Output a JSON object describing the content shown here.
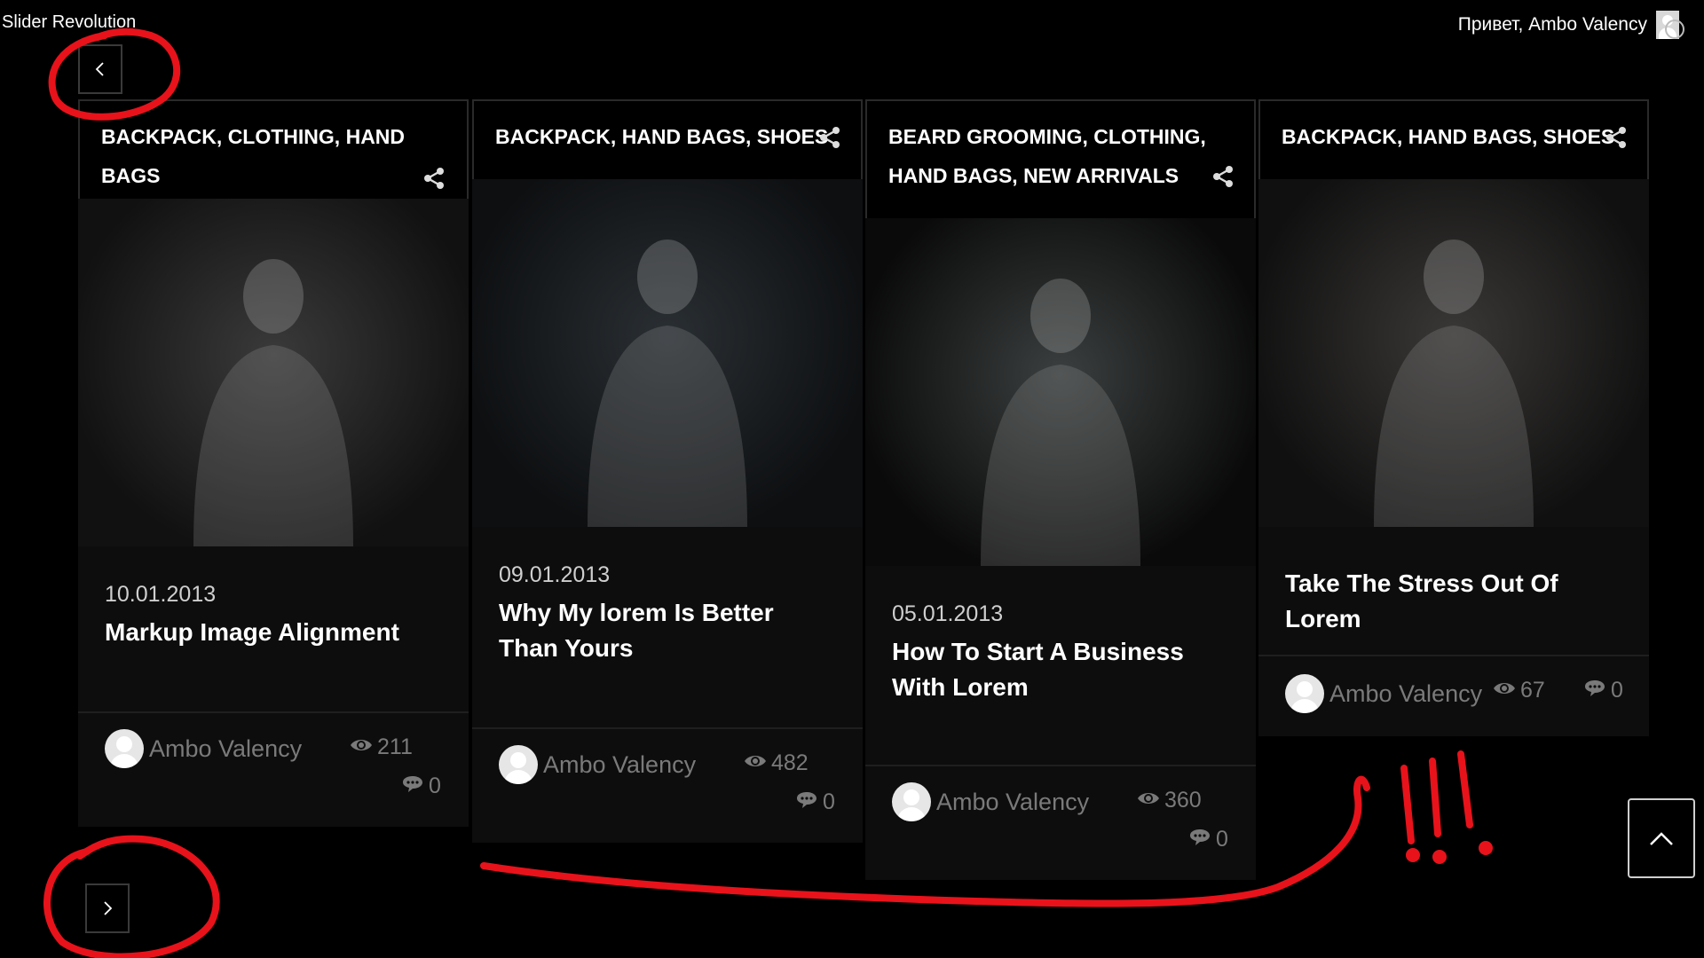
{
  "admin_bar": {
    "site_label": "Slider Revolution",
    "greeting": "Привет, Ambo Valency"
  },
  "slider": {
    "prev_icon": "chevron-left-icon",
    "next_icon": "chevron-right-icon",
    "cards": [
      {
        "categories": [
          "BACKPACK",
          "CLOTHING",
          "HAND BAGS"
        ],
        "date": "10.01.2013",
        "title": "Markup Image Alignment",
        "author": "Ambo Valency",
        "views": "211",
        "comments": "0"
      },
      {
        "categories": [
          "BACKPACK",
          "HAND BAGS",
          "SHOES"
        ],
        "date": "09.01.2013",
        "title": "Why My lorem Is Better Than Yours",
        "author": "Ambo Valency",
        "views": "482",
        "comments": "0"
      },
      {
        "categories": [
          "BEARD GROOMING",
          "CLOTHING",
          "HAND BAGS",
          "NEW ARRIVALS"
        ],
        "date": "05.01.2013",
        "title": "How To Start A Business With Lorem",
        "author": "Ambo Valency",
        "views": "360",
        "comments": "0"
      },
      {
        "categories": [
          "BACKPACK",
          "HAND BAGS",
          "SHOES"
        ],
        "date": "",
        "title": "Take The Stress Out Of Lorem",
        "author": "Ambo Valency",
        "views": "67",
        "comments": "0"
      }
    ]
  },
  "annotation": {
    "text": "!!!",
    "color": "#e8121b"
  },
  "colors": {
    "background": "#000000",
    "card": "#0d0d0d",
    "muted_text": "#7a7a7a"
  }
}
